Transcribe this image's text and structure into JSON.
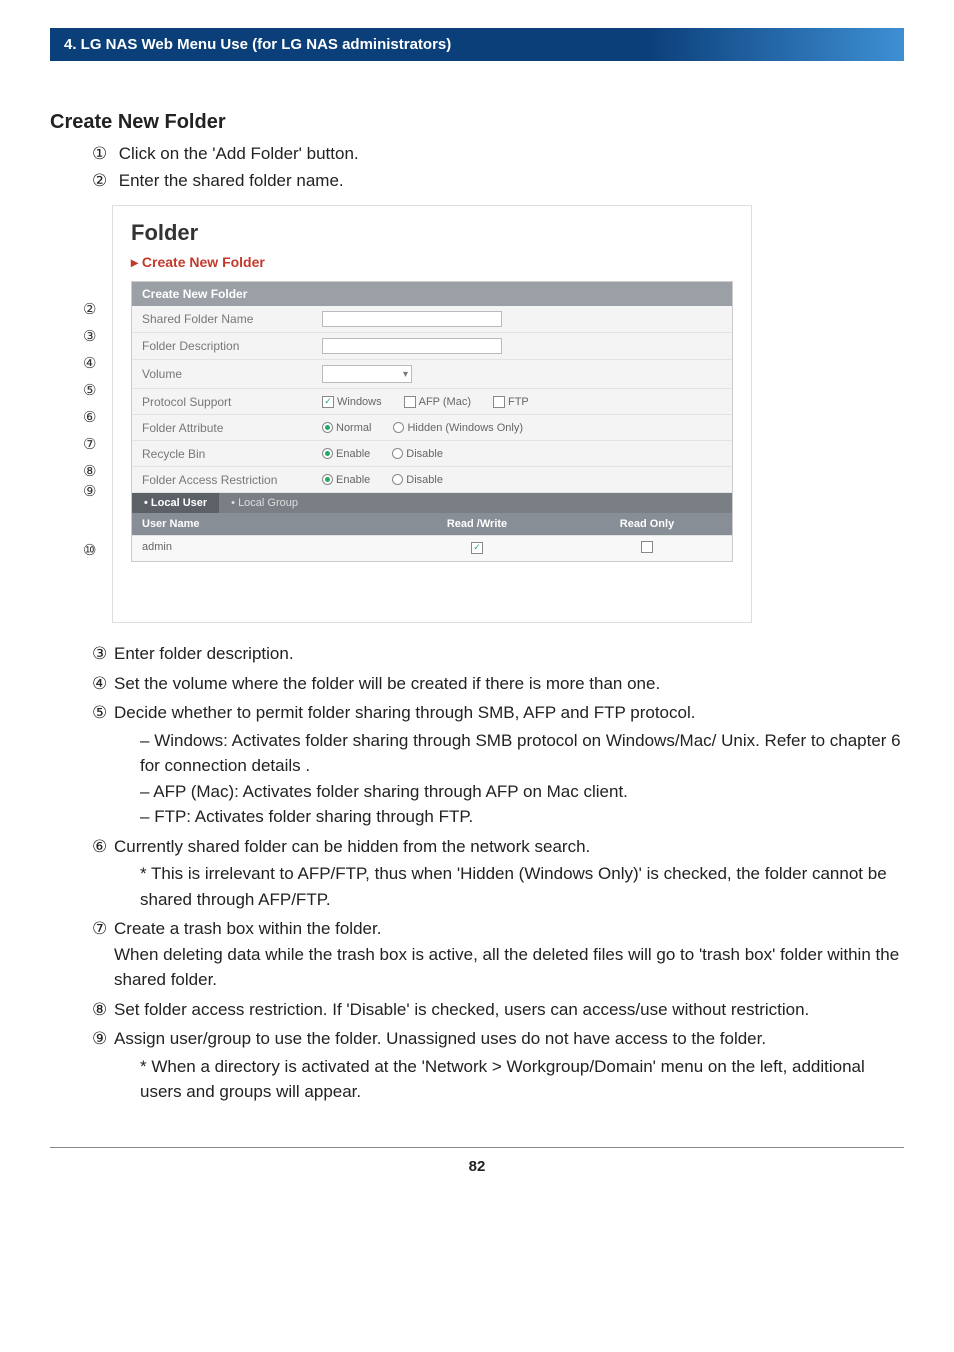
{
  "banner": "4. LG NAS Web Menu Use (for LG NAS administrators)",
  "section_title": "Create New Folder",
  "intro_steps": [
    {
      "num": "①",
      "text": "Click on the 'Add Folder' button."
    },
    {
      "num": "②",
      "text": "Enter the shared folder name."
    }
  ],
  "screenshot": {
    "title": "Folder",
    "subtitle": "Create New Folder",
    "panel_head": "Create New Folder",
    "left_nums": [
      "②",
      "③",
      "④",
      "⑤",
      "⑥",
      "⑦",
      "⑧",
      "⑨",
      "",
      "⑩"
    ],
    "rows": {
      "shared_name": "Shared Folder Name",
      "desc": "Folder Description",
      "volume": "Volume",
      "protocol": "Protocol Support",
      "attribute": "Folder Attribute",
      "recycle": "Recycle Bin",
      "restrict": "Folder Access Restriction"
    },
    "protocol_opts": {
      "win": "Windows",
      "afp": "AFP (Mac)",
      "ftp": "FTP"
    },
    "attribute_opts": {
      "normal": "Normal",
      "hidden": "Hidden (Windows Only)"
    },
    "ed": {
      "enable": "Enable",
      "disable": "Disable"
    },
    "tabs": {
      "local_user": "• Local User",
      "local_group": "• Local Group"
    },
    "tbl": {
      "user": "User Name",
      "rw": "Read /Write",
      "ro": "Read Only"
    },
    "row_user": "admin"
  },
  "steps2": [
    {
      "num": "③",
      "text": "Enter folder description."
    },
    {
      "num": "④",
      "text": "Set the volume where the folder will be created if there is more than one."
    },
    {
      "num": "⑤",
      "text": "Decide whether to permit folder sharing through SMB, AFP and FTP protocol.",
      "sub": [
        "Windows: Activates folder sharing through SMB protocol on Windows/Mac/ Unix. Refer to chapter 6 for connection details .",
        "AFP (Mac): Activates folder sharing through AFP on Mac client.",
        "FTP: Activates folder sharing through FTP."
      ]
    },
    {
      "num": "⑥",
      "text": "Currently shared folder can be hidden from the network search.",
      "note": "* This is irrelevant to AFP/FTP, thus when 'Hidden (Windows Only)' is checked, the folder cannot be shared through AFP/FTP."
    },
    {
      "num": "⑦",
      "text": "Create a trash box within the folder.",
      "cont": "When deleting data while the trash box is active, all the deleted files will go to 'trash box' folder within the shared folder."
    },
    {
      "num": "⑧",
      "text": "Set folder access restriction. If 'Disable' is checked, users can access/use without restriction."
    },
    {
      "num": "⑨",
      "text": "Assign user/group to use the folder. Unassigned uses do not have access to the folder.",
      "note": "* When a directory is activated at the 'Network > Workgroup/Domain' menu on the left, additional users and groups will appear."
    }
  ],
  "page_number": "82"
}
